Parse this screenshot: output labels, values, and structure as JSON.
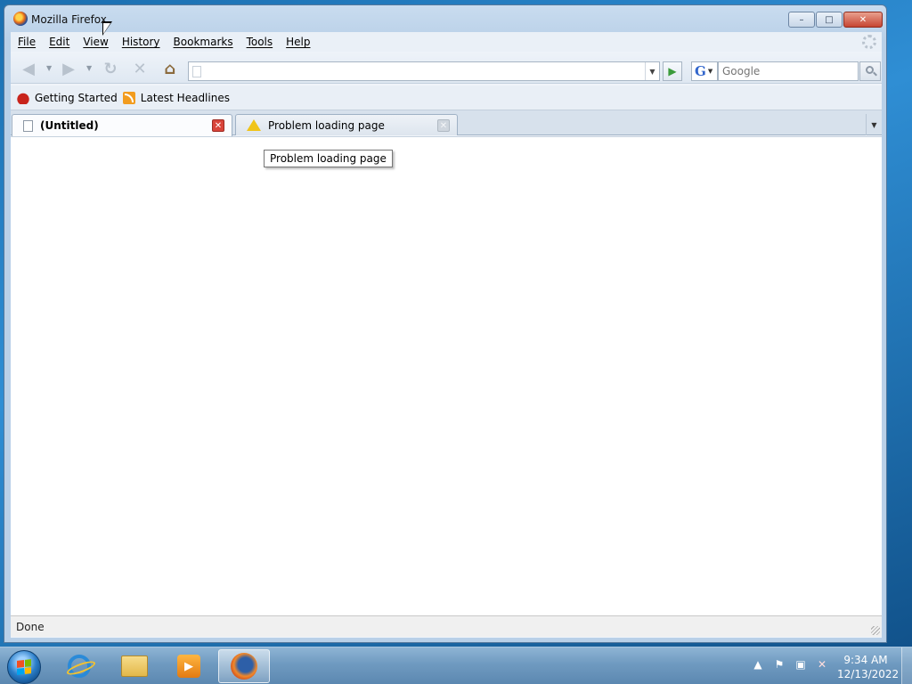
{
  "window": {
    "title": "Mozilla Firefox",
    "buttons": {
      "minimize": "–",
      "maximize": "□",
      "close": "✕"
    }
  },
  "menubar": {
    "items": [
      {
        "label": "File"
      },
      {
        "label": "Edit"
      },
      {
        "label": "View"
      },
      {
        "label": "History"
      },
      {
        "label": "Bookmarks"
      },
      {
        "label": "Tools"
      },
      {
        "label": "Help"
      }
    ]
  },
  "navbar": {
    "url_value": "",
    "search_placeholder": "Google",
    "search_engine": "G"
  },
  "bookmarks": {
    "items": [
      {
        "label": "Getting Started",
        "icon": "firefox-bookmark-icon"
      },
      {
        "label": "Latest Headlines",
        "icon": "rss-feed-icon"
      }
    ]
  },
  "tabs": [
    {
      "label": "(Untitled)",
      "icon": "page-icon",
      "active": true
    },
    {
      "label": "Problem loading page",
      "icon": "warning-icon",
      "active": false
    }
  ],
  "tooltip": {
    "text": "Problem loading page"
  },
  "statusbar": {
    "text": "Done"
  },
  "taskbar": {
    "apps": [
      {
        "name": "Internet Explorer",
        "icon": "ie-icon"
      },
      {
        "name": "Windows Explorer",
        "icon": "folder-icon"
      },
      {
        "name": "Windows Media Player",
        "icon": "media-player-icon"
      },
      {
        "name": "Mozilla Firefox",
        "icon": "firefox-icon",
        "active": true
      }
    ],
    "clock": {
      "time": "9:34 AM",
      "date": "12/13/2022"
    }
  },
  "colors": {
    "taskbar": "#6f9ac0",
    "window_frame": "#b9d0e8",
    "close_button": "#c64532"
  }
}
